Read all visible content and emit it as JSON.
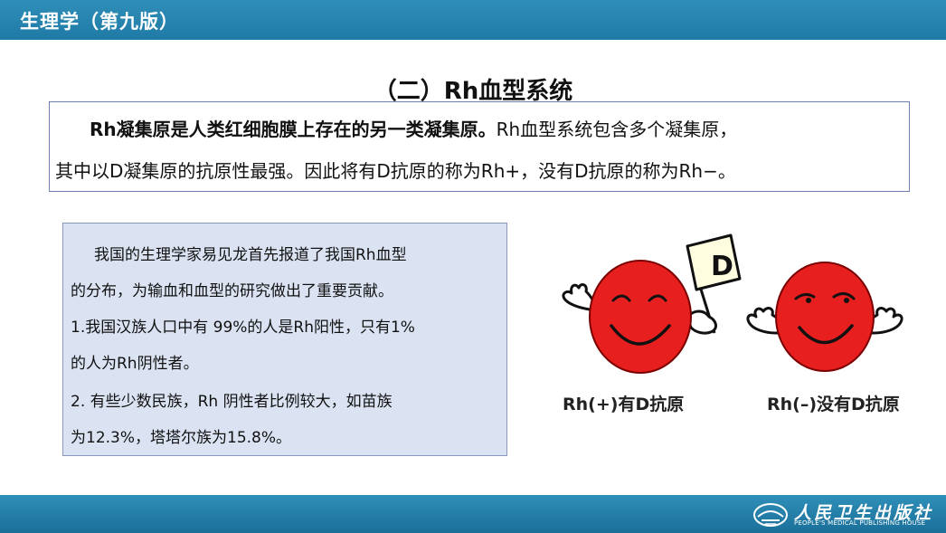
{
  "header": {
    "title": "生理学（第九版）"
  },
  "section": {
    "title": "（二）Rh血型系统"
  },
  "definition": {
    "line1_bold": "Rh凝集原是人类红细胞膜上存在的另一类凝集原。",
    "line1_rest": "Rh血型系统包含多个凝集原，",
    "line2": "其中以D凝集原的抗原性最强。因此将有D抗原的称为Rh+，没有D抗原的称为Rh−。"
  },
  "info": {
    "lines": [
      "我国的生理学家易见龙首先报道了我国Rh血型",
      "的分布，为输血和血型的研究做出了重要贡献。",
      "1.我国汉族人口中有 99%的人是Rh阳性，只有1%",
      "的人为Rh阴性者。",
      "2. 有些少数民族，Rh 阴性者比例较大，如苗族",
      "为12.3%，塔塔尔族为15.8%。"
    ]
  },
  "illustration": {
    "flag_letter": "D",
    "positive_label": "Rh(+)有D抗原",
    "negative_label": "Rh(–)没有D抗原",
    "cell_color": "#e81f1f"
  },
  "footer": {
    "publisher_cn": "人民卫生出版社",
    "publisher_en": "PEOPLE'S MEDICAL PUBLISHING HOUSE"
  }
}
